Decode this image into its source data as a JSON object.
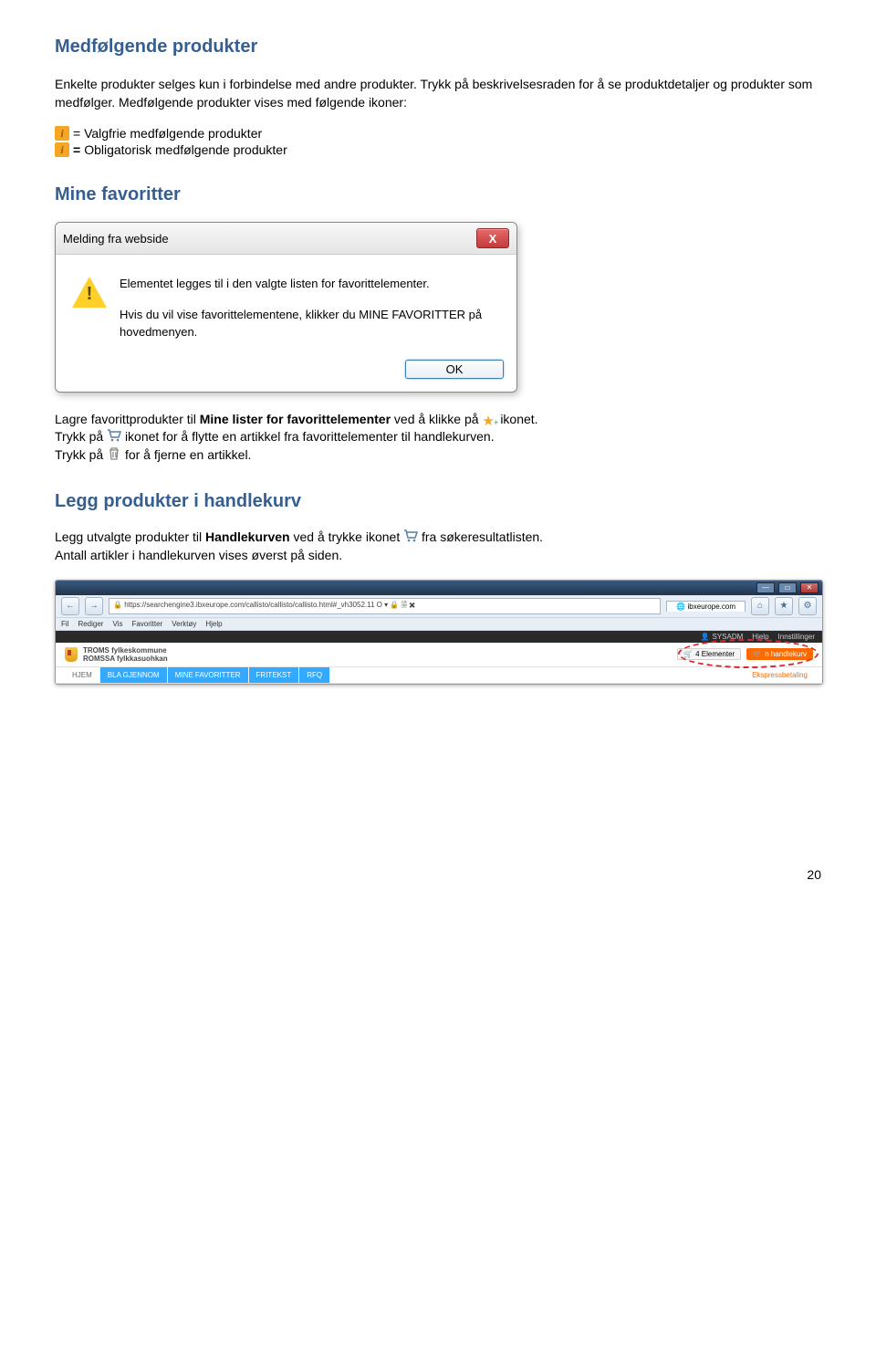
{
  "h1": "Medfølgende produkter",
  "intro": "Enkelte produkter selges kun i forbindelse med andre produkter. Trykk på beskrivelsesraden for å se produktdetaljer og produkter som medfølger. Medfølgende produkter vises med følgende ikoner:",
  "iconlines": {
    "valgfrie": "= Valgfrie medfølgende produkter",
    "oblig_eq": "= ",
    "oblig_txt": "Obligatorisk medfølgende produkter"
  },
  "h2_fav": "Mine favoritter",
  "dialog": {
    "title": "Melding fra webside",
    "msg1": "Elementet legges til i den valgte listen for favorittelementer.",
    "msg2": "Hvis du vil vise favorittelementene, klikker du MINE FAVORITTER på hovedmenyen.",
    "ok": "OK",
    "close": "X"
  },
  "fav_para": {
    "p1a": "Lagre favorittprodukter til ",
    "p1b": "Mine lister for favorittelementer",
    "p1c": " ved å klikke på ",
    "p1d": " ikonet.",
    "p2a": "Trykk på ",
    "p2b": " ikonet for å flytte en artikkel fra favorittelementer til handlekurven.",
    "p3a": "Trykk på ",
    "p3b": " for å fjerne en artikkel."
  },
  "h2_legg": "Legg produkter i handlekurv",
  "legg_para": {
    "a": "Legg utvalgte produkter til ",
    "b": "Handlekurven",
    "c": " ved å trykke ikonet ",
    "d": " fra søkeresultatlisten.",
    "line2": "Antall artikler i handlekurven vises øverst på siden."
  },
  "browser": {
    "url": "https://searchengine3.ibxeurope.com/callisto/callisto/callisto.html#_vh3052.11",
    "lock_tail": "O ▾ 🔒 🗟 ✖ ",
    "tab": "ibxeurope.com",
    "menus": [
      "Fil",
      "Rediger",
      "Vis",
      "Favoritter",
      "Verktøy",
      "Hjelp"
    ],
    "user_icon": "👤",
    "user": "SYSADM",
    "top_links": [
      "Hjelp",
      "Innstillinger"
    ],
    "org1": "TROMS fylkeskommune",
    "org2": "ROMSSA fylkkasuohkan",
    "cart_count_icon": "🛒",
    "cart_count": "4 Elementer",
    "cart_btn_icon": "🛒",
    "cart_btn": "n handlekurv",
    "tabs": [
      "HJEM",
      "BLA GJENNOM",
      "MINE FAVORITTER",
      "FRITEKST",
      "RFQ"
    ],
    "ekspress": "Ekspressbetaling",
    "win": {
      "min": "—",
      "max": "▭",
      "close": "✕"
    }
  },
  "pagenum": "20"
}
